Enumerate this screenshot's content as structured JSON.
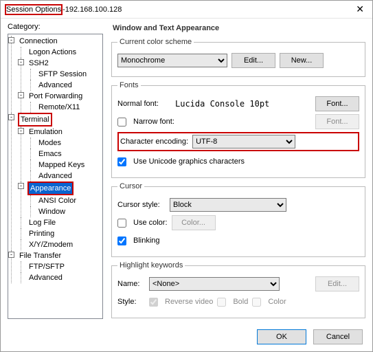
{
  "title_a": "Session Options",
  "title_sep": " - ",
  "title_b": "192.168.100.128",
  "close_glyph": "✕",
  "category_label": "Category:",
  "tree": {
    "connection": "Connection",
    "logon": "Logon Actions",
    "ssh2": "SSH2",
    "sftp": "SFTP Session",
    "advanced1": "Advanced",
    "portfwd": "Port Forwarding",
    "remotex11": "Remote/X11",
    "terminal": "Terminal",
    "emulation": "Emulation",
    "modes": "Modes",
    "emacs": "Emacs",
    "mapped": "Mapped Keys",
    "advanced2": "Advanced",
    "appearance": "Appearance",
    "ansi": "ANSI Color",
    "windownode": "Window",
    "logfile": "Log File",
    "printing": "Printing",
    "xymodem": "X/Y/Zmodem",
    "filetransfer": "File Transfer",
    "ftpsftp": "FTP/SFTP",
    "advanced3": "Advanced"
  },
  "panel_title": "Window and Text Appearance",
  "scheme": {
    "legend": "Current color scheme",
    "value": "Monochrome",
    "edit": "Edit...",
    "new": "New..."
  },
  "fonts": {
    "legend": "Fonts",
    "normal_label": "Normal font:",
    "normal_value": "Lucida Console 10pt",
    "font_btn": "Font...",
    "narrow_label": "Narrow font:",
    "enc_label": "Character encoding:",
    "enc_value": "UTF-8",
    "unicode_label": "Use Unicode graphics characters"
  },
  "cursor": {
    "legend": "Cursor",
    "style_label": "Cursor style:",
    "style_value": "Block",
    "usecolor_label": "Use color:",
    "color_btn": "Color...",
    "blinking_label": "Blinking"
  },
  "hk": {
    "legend": "Highlight keywords",
    "name_label": "Name:",
    "name_value": "<None>",
    "edit": "Edit...",
    "style_label": "Style:",
    "reverse": "Reverse video",
    "bold": "Bold",
    "color": "Color"
  },
  "ok": "OK",
  "cancel": "Cancel"
}
